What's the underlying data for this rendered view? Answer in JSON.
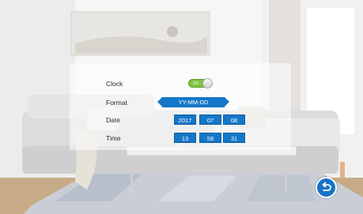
{
  "settings": {
    "clock": {
      "label": "Clock",
      "toggle_text": "on"
    },
    "format": {
      "label": "Format",
      "value": "YY-MM-DD"
    },
    "date": {
      "label": "Date",
      "year": "2017",
      "month": "07",
      "day": "08"
    },
    "time": {
      "label": "Time",
      "hour": "13",
      "minute": "58",
      "second": "31"
    }
  },
  "controls": {
    "back_icon": "return-arrow-icon"
  },
  "colors": {
    "accent": "#1577c8",
    "toggle_on": "#7ec43f"
  }
}
